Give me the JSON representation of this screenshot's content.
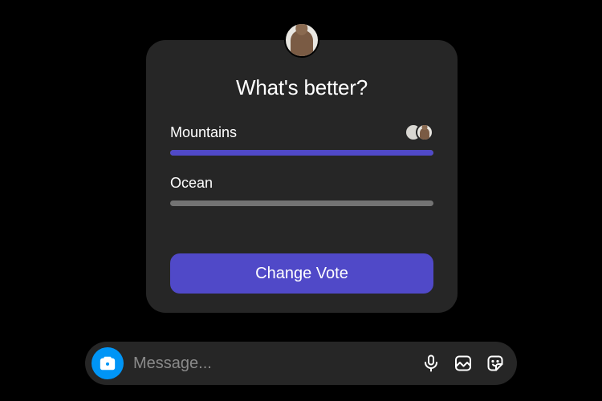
{
  "poll": {
    "title": "What's better?",
    "options": [
      {
        "label": "Mountains",
        "fill_percent": 100,
        "fill_color": "#5049c8",
        "voter_avatars": 2
      },
      {
        "label": "Ocean",
        "fill_percent": 0,
        "fill_color": "#5049c8",
        "voter_avatars": 0
      }
    ],
    "change_vote_label": "Change Vote"
  },
  "composer": {
    "placeholder": "Message..."
  },
  "colors": {
    "card_bg": "#262626",
    "accent": "#5049c8",
    "camera_blue": "#0095f6",
    "track": "#737373"
  }
}
